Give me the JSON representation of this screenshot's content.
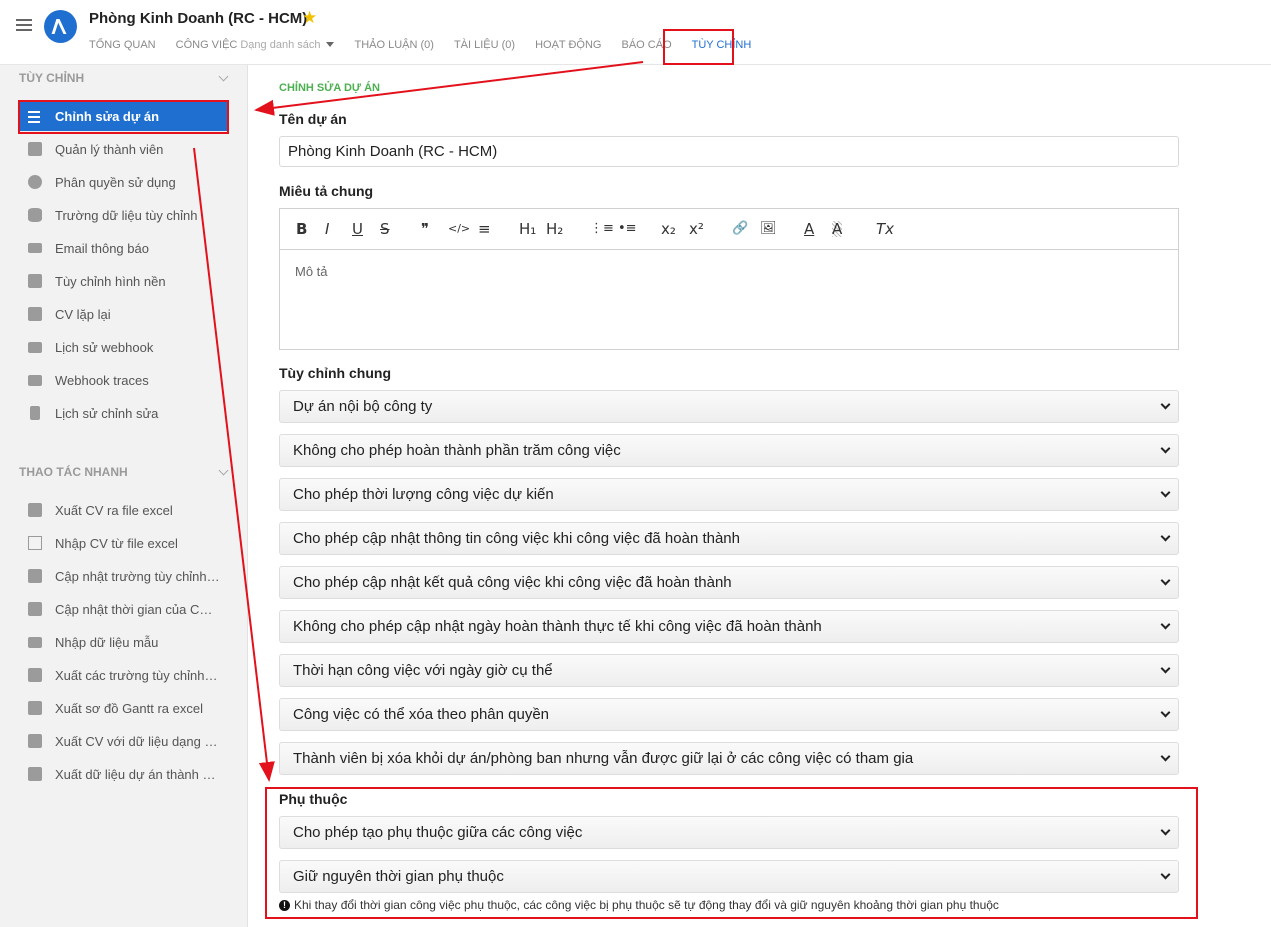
{
  "header": {
    "title": "Phòng Kinh Doanh (RC - HCM)",
    "tabs": [
      {
        "label": "TỔNG QUAN"
      },
      {
        "label": "CÔNG VIỆC",
        "sub": "Dạng danh sách"
      },
      {
        "label": "THẢO LUẬN (0)"
      },
      {
        "label": "TÀI LIỆU (0)"
      },
      {
        "label": "HOẠT ĐỘNG"
      },
      {
        "label": "BÁO CÁO"
      },
      {
        "label": "TÙY CHỈNH"
      }
    ]
  },
  "sidebar": {
    "section1": "TÙY CHỈNH",
    "items1": [
      {
        "label": "Chỉnh sửa dự án",
        "icon": "list-icon"
      },
      {
        "label": "Quản lý thành viên",
        "icon": "user-badge-icon"
      },
      {
        "label": "Phân quyền sử dụng",
        "icon": "person-circle-icon"
      },
      {
        "label": "Trường dữ liệu tùy chỉnh",
        "icon": "database-icon"
      },
      {
        "label": "Email thông báo",
        "icon": "envelope-icon"
      },
      {
        "label": "Tùy chỉnh hình nền",
        "icon": "pencil-icon"
      },
      {
        "label": "CV lặp lại",
        "icon": "calendar-icon"
      },
      {
        "label": "Lịch sử webhook",
        "icon": "flag-icon"
      },
      {
        "label": "Webhook traces",
        "icon": "flag-icon"
      },
      {
        "label": "Lịch sử chỉnh sửa",
        "icon": "hourglass-icon"
      }
    ],
    "section2": "THAO TÁC NHANH",
    "items2": [
      {
        "label": "Xuất CV ra file excel",
        "icon": "export-icon"
      },
      {
        "label": "Nhập CV từ file excel",
        "icon": "excel-file-icon"
      },
      {
        "label": "Cập nhật trường tùy chỉnh ...",
        "icon": "cube-icon"
      },
      {
        "label": "Cập nhật thời gian của CV ...",
        "icon": "cube-icon"
      },
      {
        "label": "Nhập dữ liệu mẫu",
        "icon": "folder-icon"
      },
      {
        "label": "Xuất các trường tùy chỉnh r...",
        "icon": "export-icon"
      },
      {
        "label": "Xuất sơ đồ Gantt ra excel",
        "icon": "export-icon"
      },
      {
        "label": "Xuất CV với dữ liệu dạng b...",
        "icon": "export-icon"
      },
      {
        "label": "Xuất dữ liệu dự án thành m...",
        "icon": "export-icon"
      }
    ]
  },
  "main": {
    "section_title": "CHỈNH SỬA DỰ ÁN",
    "name_label": "Tên dự án",
    "name_value": "Phòng Kinh Doanh (RC - HCM)",
    "desc_label": "Miêu tả chung",
    "desc_placeholder": "Mô tả",
    "toolbar": [
      "B",
      "I",
      "U",
      "S",
      "❞",
      "</>",
      "≡",
      "H₁",
      "H₂",
      "⋮≡",
      "•≡",
      "x₂",
      "x²",
      "🔗",
      "🖼",
      "A",
      "A",
      "Tx"
    ],
    "general_label": "Tùy chỉnh chung",
    "general_selects": [
      "Dự án nội bộ công ty",
      "Không cho phép hoàn thành phần trăm công việc",
      "Cho phép thời lượng công việc dự kiến",
      "Cho phép cập nhật thông tin công việc khi công việc đã hoàn thành",
      "Cho phép cập nhật kết quả công việc khi công việc đã hoàn thành",
      "Không cho phép cập nhật ngày hoàn thành thực tế khi công việc đã hoàn thành",
      "Thời hạn công việc với ngày giờ cụ thể",
      "Công việc có thể xóa theo phân quyền",
      "Thành viên bị xóa khỏi dự án/phòng ban nhưng vẫn được giữ lại ở các công việc có tham gia"
    ],
    "dependency_label": "Phụ thuộc",
    "dependency_selects": [
      "Cho phép tạo phụ thuộc giữa các công việc",
      "Giữ nguyên thời gian phụ thuộc"
    ],
    "dependency_note": "Khi thay đổi thời gian công việc phụ thuộc, các công việc bị phụ thuộc sẽ tự động thay đổi và giữ nguyên khoảng thời gian phụ thuộc"
  },
  "colors": {
    "accent": "#1f6fd1",
    "annotation": "#e3111b",
    "section_green": "#4caf50"
  }
}
